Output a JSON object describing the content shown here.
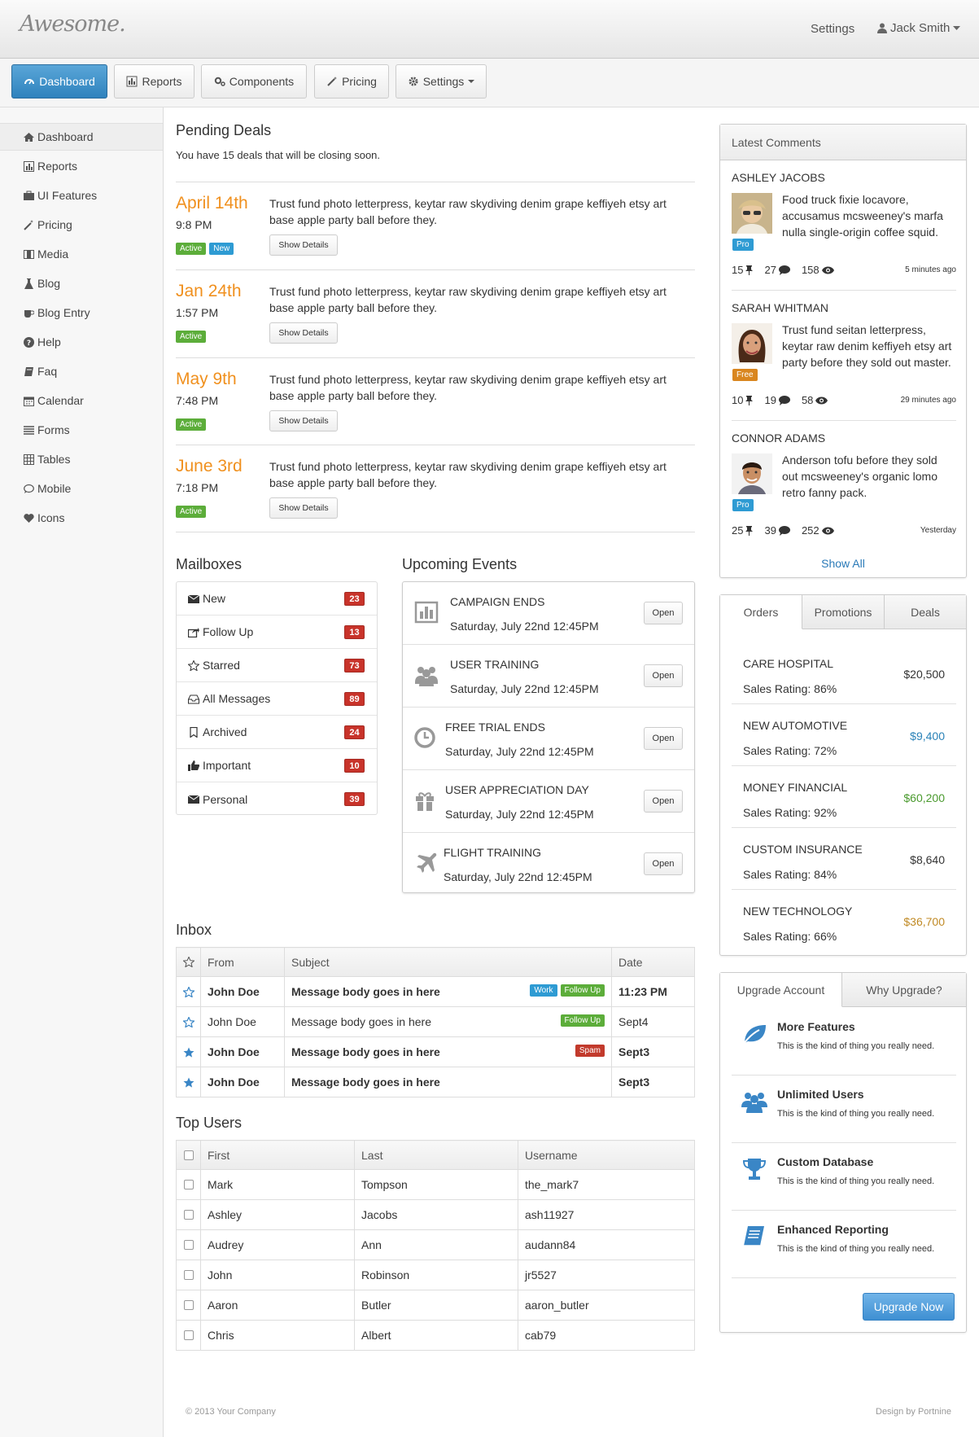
{
  "header": {
    "logo": "Awesome.",
    "settings": "Settings",
    "user": "Jack Smith"
  },
  "nav": [
    "Dashboard",
    "Reports",
    "Components",
    "Pricing",
    "Settings"
  ],
  "sidebar": [
    "Dashboard",
    "Reports",
    "UI Features",
    "Pricing",
    "Media",
    "Blog",
    "Blog Entry",
    "Help",
    "Faq",
    "Calendar",
    "Forms",
    "Tables",
    "Mobile",
    "Icons"
  ],
  "pending": {
    "title": "Pending Deals",
    "subtitle": "You have 15 deals that will be closing soon.",
    "button": "Show Details",
    "deals": [
      {
        "date": "April 14th",
        "time": "9:8 PM",
        "text": "Trust fund photo letterpress, keytar raw skydiving denim grape keffiyeh etsy art base apple party ball before they.",
        "badges": [
          "Active",
          "New"
        ]
      },
      {
        "date": "Jan 24th",
        "time": "1:57 PM",
        "text": "Trust fund photo letterpress, keytar raw skydiving denim grape keffiyeh etsy art base apple party ball before they.",
        "badges": [
          "Active"
        ]
      },
      {
        "date": "May 9th",
        "time": "7:48 PM",
        "text": "Trust fund photo letterpress, keytar raw skydiving denim grape keffiyeh etsy art base apple party ball before they.",
        "badges": [
          "Active"
        ]
      },
      {
        "date": "June 3rd",
        "time": "7:18 PM",
        "text": "Trust fund photo letterpress, keytar raw skydiving denim grape keffiyeh etsy art base apple party ball before they.",
        "badges": [
          "Active"
        ]
      }
    ]
  },
  "mailboxes": {
    "title": "Mailboxes",
    "items": [
      {
        "label": "New",
        "count": "23",
        "icon": "envelope-icon"
      },
      {
        "label": "Follow Up",
        "count": "13",
        "icon": "share-icon"
      },
      {
        "label": "Starred",
        "count": "73",
        "icon": "star-icon"
      },
      {
        "label": "All Messages",
        "count": "89",
        "icon": "inbox-icon"
      },
      {
        "label": "Archived",
        "count": "24",
        "icon": "bookmark-icon"
      },
      {
        "label": "Important",
        "count": "10",
        "icon": "thumbs-up-icon"
      },
      {
        "label": "Personal",
        "count": "39",
        "icon": "envelope-icon"
      }
    ]
  },
  "events": {
    "title": "Upcoming Events",
    "button": "Open",
    "items": [
      {
        "name": "CAMPAIGN ENDS",
        "date": "Saturday, July 22nd 12:45PM",
        "icon": "bar-chart-icon"
      },
      {
        "name": "USER TRAINING",
        "date": "Saturday, July 22nd 12:45PM",
        "icon": "group-icon"
      },
      {
        "name": "FREE TRIAL ENDS",
        "date": "Saturday, July 22nd 12:45PM",
        "icon": "clock-icon"
      },
      {
        "name": "USER APPRECIATION DAY",
        "date": "Saturday, July 22nd 12:45PM",
        "icon": "gift-icon"
      },
      {
        "name": "FLIGHT TRAINING",
        "date": "Saturday, July 22nd 12:45PM",
        "icon": "plane-icon"
      }
    ]
  },
  "inbox": {
    "title": "Inbox",
    "headers": [
      "From",
      "Subject",
      "Date"
    ],
    "rows": [
      {
        "from": "John Doe",
        "subject": "Message body goes in here",
        "date": "11:23 PM",
        "tags": [
          "Work",
          "Follow Up"
        ],
        "bold": true,
        "starred": false
      },
      {
        "from": "John Doe",
        "subject": "Message body goes in here",
        "date": "Sept4",
        "tags": [
          "Follow Up"
        ],
        "bold": false,
        "starred": false
      },
      {
        "from": "John Doe",
        "subject": "Message body goes in here",
        "date": "Sept3",
        "tags": [
          "Spam"
        ],
        "bold": true,
        "starred": true
      },
      {
        "from": "John Doe",
        "subject": "Message body goes in here",
        "date": "Sept3",
        "tags": [],
        "bold": true,
        "starred": true
      }
    ]
  },
  "top_users": {
    "title": "Top Users",
    "headers": [
      "First",
      "Last",
      "Username"
    ],
    "rows": [
      [
        "Mark",
        "Tompson",
        "the_mark7"
      ],
      [
        "Ashley",
        "Jacobs",
        "ash11927"
      ],
      [
        "Audrey",
        "Ann",
        "audann84"
      ],
      [
        "John",
        "Robinson",
        "jr5527"
      ],
      [
        "Aaron",
        "Butler",
        "aaron_butler"
      ],
      [
        "Chris",
        "Albert",
        "cab79"
      ]
    ]
  },
  "comments": {
    "title": "Latest Comments",
    "show_all": "Show All",
    "items": [
      {
        "name": "ASHLEY JACOBS",
        "text": "Food truck fixie locavore, accusamus mcsweeney's marfa nulla single-origin coffee squid.",
        "tag": "Pro",
        "pins": "15",
        "comments": "27",
        "views": "158",
        "ago": "5 minutes ago"
      },
      {
        "name": "SARAH WHITMAN",
        "text": "Trust fund seitan letterpress, keytar raw denim keffiyeh etsy art party before they sold out master.",
        "tag": "Free",
        "pins": "10",
        "comments": "19",
        "views": "58",
        "ago": "29 minutes ago"
      },
      {
        "name": "CONNOR ADAMS",
        "text": "Anderson tofu before they sold out mcsweeney's organic lomo retro fanny pack.",
        "tag": "Pro",
        "pins": "25",
        "comments": "39",
        "views": "252",
        "ago": "Yesterday"
      }
    ]
  },
  "orders": {
    "tabs": [
      "Orders",
      "Promotions",
      "Deals"
    ],
    "items": [
      {
        "name": "CARE HOSPITAL",
        "rating": "Sales Rating: 86%",
        "amount": "$20,500",
        "color": "#333333"
      },
      {
        "name": "NEW AUTOMOTIVE",
        "rating": "Sales Rating: 72%",
        "amount": "$9,400",
        "color": "#2a82b8"
      },
      {
        "name": "MONEY FINANCIAL",
        "rating": "Sales Rating: 92%",
        "amount": "$60,200",
        "color": "#4a9a2e"
      },
      {
        "name": "CUSTOM INSURANCE",
        "rating": "Sales Rating: 84%",
        "amount": "$8,640",
        "color": "#333333"
      },
      {
        "name": "NEW TECHNOLOGY",
        "rating": "Sales Rating: 66%",
        "amount": "$36,700",
        "color": "#c08a25"
      }
    ]
  },
  "upgrade": {
    "tabs": [
      "Upgrade Account",
      "Why Upgrade?"
    ],
    "button": "Upgrade Now",
    "features": [
      {
        "title": "More Features",
        "desc": "This is the kind of thing you really need.",
        "icon": "leaf-icon"
      },
      {
        "title": "Unlimited Users",
        "desc": "This is the kind of thing you really need.",
        "icon": "group-icon"
      },
      {
        "title": "Custom Database",
        "desc": "This is the kind of thing you really need.",
        "icon": "trophy-icon"
      },
      {
        "title": "Enhanced Reporting",
        "desc": "This is the kind of thing you really need.",
        "icon": "book-icon"
      }
    ]
  },
  "footer": {
    "left": "© 2013 Your Company",
    "right": "Design by Portnine"
  },
  "colors": {
    "accent": "#2e82bd",
    "deal_date": "#f0901e",
    "count_badge": "#c8332a",
    "icon_blue": "#3a86c6"
  }
}
